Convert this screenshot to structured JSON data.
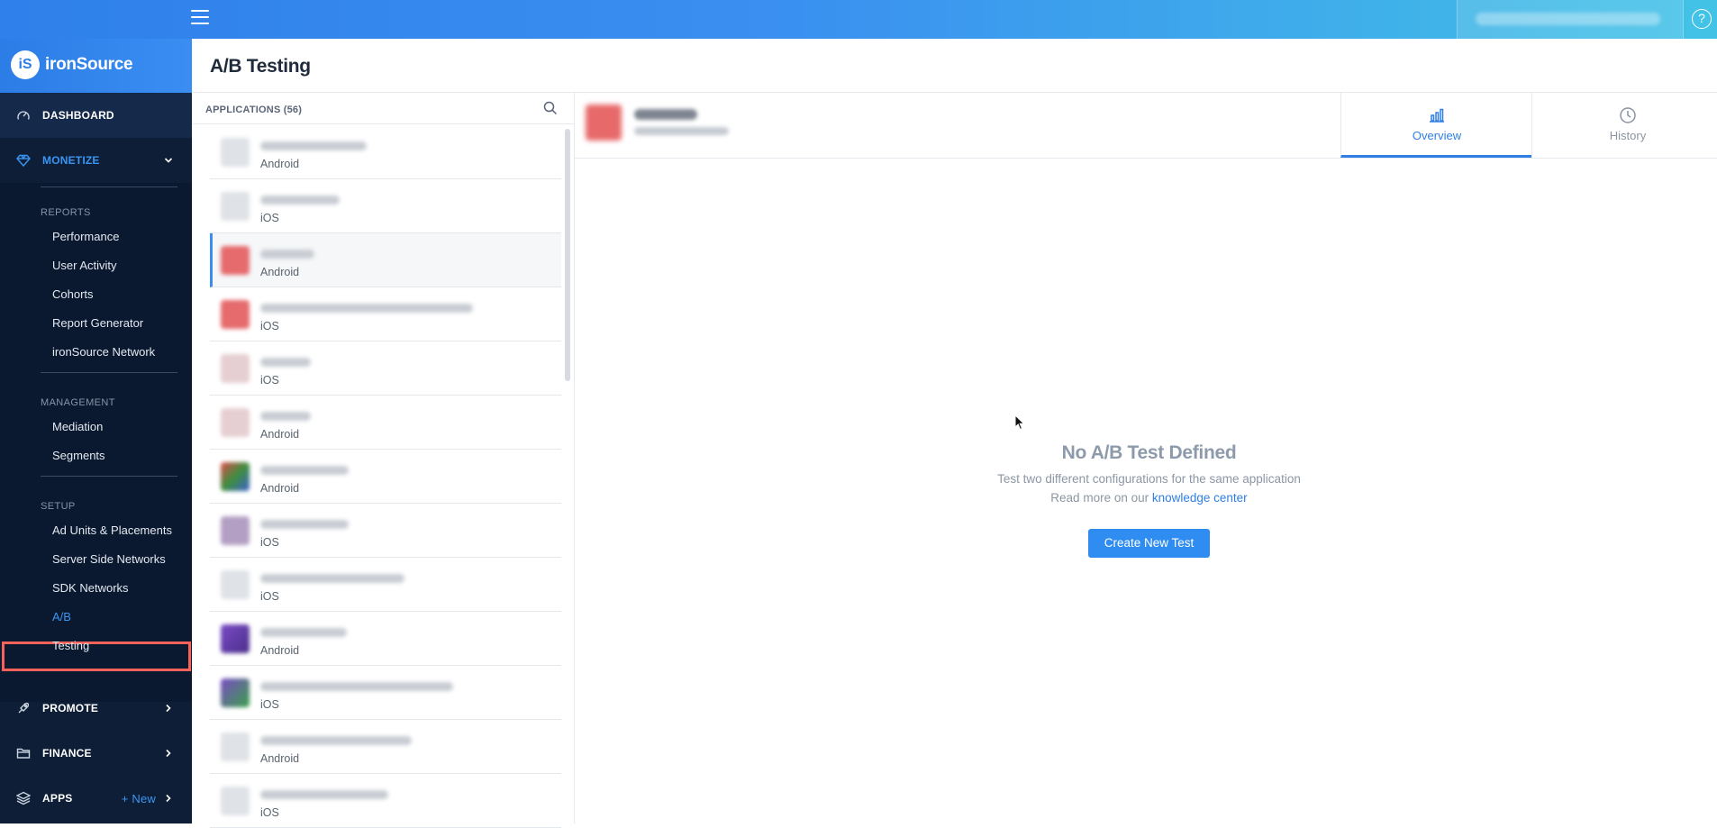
{
  "brand": {
    "logo_mark": "iS",
    "name": "ironSource"
  },
  "topbar": {
    "help_glyph": "?",
    "menu_icon": "hamburger-icon"
  },
  "nav": {
    "dashboard": "DASHBOARD",
    "monetize": "MONETIZE",
    "promote": "PROMOTE",
    "finance": "FINANCE",
    "apps": "APPS",
    "apps_new": "+ New"
  },
  "monetize_menu": {
    "reports_title": "REPORTS",
    "reports": [
      "Performance",
      "User Activity",
      "Cohorts",
      "Report Generator",
      "ironSource Network"
    ],
    "management_title": "MANAGEMENT",
    "management": [
      "Mediation",
      "Segments"
    ],
    "setup_title": "SETUP",
    "setup": [
      "Ad Units & Placements",
      "Server Side Networks",
      "SDK Networks",
      "A/B",
      "Testing"
    ]
  },
  "page": {
    "title": "A/B Testing"
  },
  "apps_panel": {
    "title": "APPLICATIONS (56)",
    "items": [
      {
        "platform": "Android"
      },
      {
        "platform": "iOS"
      },
      {
        "platform": "Android"
      },
      {
        "platform": "iOS"
      },
      {
        "platform": "iOS"
      },
      {
        "platform": "Android"
      },
      {
        "platform": "Android"
      },
      {
        "platform": "iOS"
      },
      {
        "platform": "iOS"
      },
      {
        "platform": "Android"
      },
      {
        "platform": "iOS"
      },
      {
        "platform": "Android"
      },
      {
        "platform": "iOS"
      }
    ]
  },
  "detail": {
    "tabs": {
      "overview": "Overview",
      "history": "History"
    },
    "empty_title": "No A/B Test Defined",
    "empty_desc": "Test two different configurations for the same application",
    "empty_more_prefix": "Read more on our ",
    "empty_more_link": "knowledge center",
    "create_button": "Create New Test"
  },
  "colors": {
    "accent": "#2f8cf0",
    "sidebar_bg": "#0d1e36",
    "highlight": "#f4625a"
  }
}
